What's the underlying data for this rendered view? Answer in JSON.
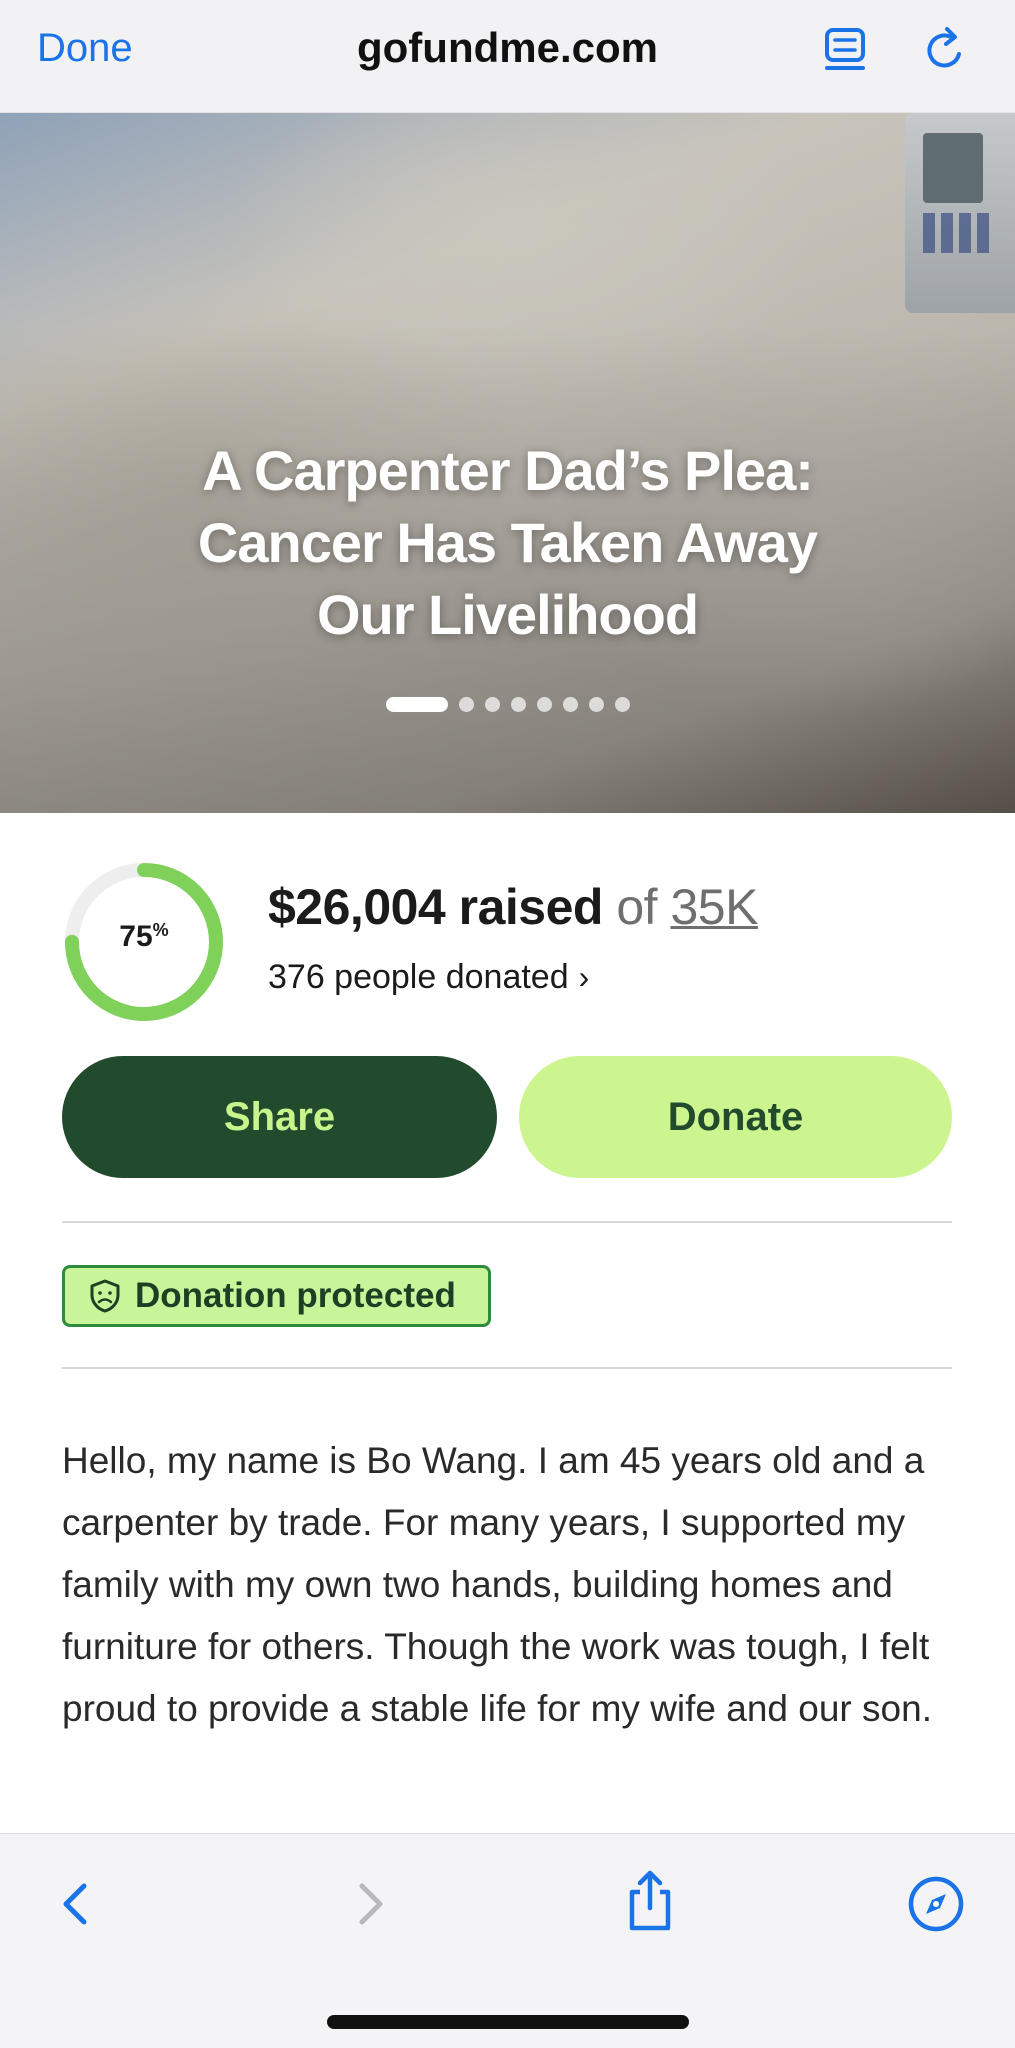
{
  "browser": {
    "done_label": "Done",
    "url": "gofundme.com",
    "icons": {
      "reader": "reader-list-icon",
      "reload": "reload-icon"
    }
  },
  "hero": {
    "title": "A Carpenter Dad’s Plea: Cancer Has Taken Away Our Livelihood",
    "carousel": {
      "total": 8,
      "active": 1
    }
  },
  "progress": {
    "percent_value": 0.75,
    "percent_number": "75",
    "percent_sign": "%",
    "raised_amount": "$26,004 raised",
    "of_label": "of",
    "goal": "35K",
    "donors": "376 people donated",
    "donors_chevron": "›"
  },
  "actions": {
    "share_label": "Share",
    "donate_label": "Donate"
  },
  "badge": {
    "label": "Donation protected"
  },
  "story": {
    "text": "Hello, my name is Bo Wang. I am 45 years old and a carpenter by trade. For many years, I supported my family with my own two hands, building homes and furniture for others. Though the work was tough, I felt proud to provide a stable life for my wife and our son."
  },
  "toolbar": {
    "icons": [
      "back-icon",
      "forward-icon",
      "share-icon",
      "compass-icon"
    ]
  },
  "colors": {
    "link_blue": "#1a73e8",
    "share_bg": "#224a2d",
    "share_text": "#c8f48c",
    "donate_bg": "#cdf58f",
    "ring_green": "#7fd15a",
    "badge_bg": "#c9f59a",
    "badge_border": "#2e8b3c"
  }
}
